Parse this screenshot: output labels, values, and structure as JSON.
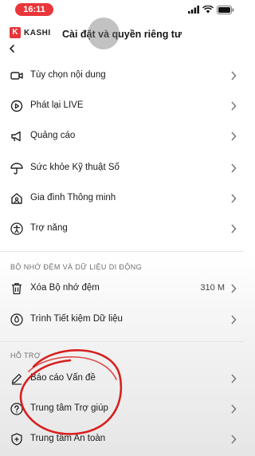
{
  "status_bar": {
    "time": "16:11"
  },
  "header": {
    "brand": "KASHI",
    "brand_initial": "K",
    "title": "Cài đặt và quyền riêng tư"
  },
  "items_main": [
    {
      "label": "Tùy chọn nội dung",
      "icon": "video-camera-icon"
    },
    {
      "label": "Phát lại LIVE",
      "icon": "live-replay-icon"
    },
    {
      "label": "Quảng cáo",
      "icon": "megaphone-icon"
    },
    {
      "label": "Sức khỏe Kỹ thuật Số",
      "icon": "umbrella-icon"
    },
    {
      "label": "Gia đình Thông minh",
      "icon": "family-house-icon"
    },
    {
      "label": "Trợ năng",
      "icon": "accessibility-icon"
    }
  ],
  "section_cache": {
    "title": "BỘ NHỚ ĐỆM VÀ DỮ LIỆU DI ĐỘNG",
    "items": [
      {
        "label": "Xóa Bộ nhớ đệm",
        "value": "310 M",
        "icon": "trash-icon"
      },
      {
        "label": "Trình Tiết kiệm Dữ liệu",
        "icon": "data-saver-icon"
      }
    ]
  },
  "section_support": {
    "title": "HỖ TRỢ",
    "items": [
      {
        "label": "Báo cáo Vấn đề",
        "icon": "pencil-icon"
      },
      {
        "label": "Trung tâm Trợ giúp",
        "icon": "help-circle-icon"
      },
      {
        "label": "Trung tâm An toàn",
        "icon": "shield-plus-icon"
      }
    ]
  },
  "colors": {
    "accent": "#e8363a",
    "annotation": "#d81f1f"
  }
}
